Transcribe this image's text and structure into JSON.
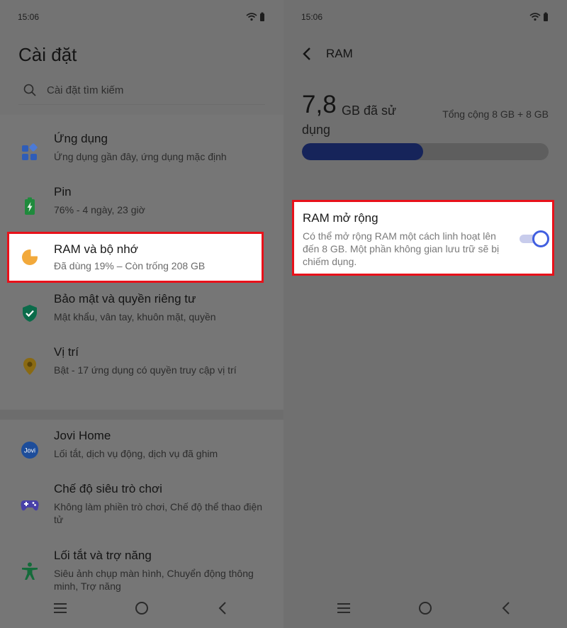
{
  "left": {
    "status_time": "15:06",
    "title": "Cài đặt",
    "search_placeholder": "Cài đặt tìm kiếm",
    "items": [
      {
        "title": "Ứng dụng",
        "subtitle": "Ứng dụng gần đây, ứng dụng mặc định",
        "icon": "apps-icon"
      },
      {
        "title": "Pin",
        "subtitle": "76% - 4 ngày, 23 giờ",
        "icon": "battery-icon"
      },
      {
        "title": "RAM và bộ nhớ",
        "subtitle": "Đã dùng 19% – Còn trống 208 GB",
        "icon": "storage-pie-icon"
      },
      {
        "title": "Bảo mật và quyền riêng tư",
        "subtitle": "Mật khẩu, vân tay, khuôn mặt, quyền",
        "icon": "shield-icon"
      },
      {
        "title": "Vị trí",
        "subtitle": "Bật - 17 ứng dụng có quyền truy cập vị trí",
        "icon": "location-icon"
      },
      {
        "title": "Jovi Home",
        "subtitle": "Lối tắt, dịch vụ động, dịch vụ đã ghim",
        "icon": "jovi-icon",
        "icon_text": "Jovi"
      },
      {
        "title": "Chế độ siêu trò chơi",
        "subtitle": "Không làm phiền trò chơi, Chế độ thể thao điện tử",
        "icon": "gamepad-icon"
      },
      {
        "title": "Lối tắt và trợ năng",
        "subtitle": "Siêu ảnh chụp màn hình, Chuyển động thông minh, Trợ năng",
        "icon": "accessibility-icon"
      }
    ]
  },
  "right": {
    "status_time": "15:06",
    "title": "RAM",
    "used_value": "7,8",
    "used_unit_line1": "GB đã sử",
    "used_unit_line2": "dụng",
    "total": "Tổng cộng 8 GB + 8 GB",
    "usage_fraction": 0.49,
    "extended": {
      "title": "RAM mở rộng",
      "description": "Có thể mở rộng RAM một cách linh hoạt lên đến 8 GB. Một phần không gian lưu trữ sẽ bị chiếm dụng.",
      "enabled": true
    }
  },
  "colors": {
    "highlight": "#e8111a",
    "apps_icon": "#2f5db8",
    "battery_icon": "#1f8a3c",
    "storage_icon": "#f2a93b",
    "shield_icon": "#0b6b4a",
    "location_icon": "#8a6a12",
    "jovi_icon": "#1d4d9a",
    "gamepad_icon": "#4840a8",
    "accessibility_icon": "#146b3a",
    "toggle_on": "#415fe0",
    "bar_fill": "#16245a"
  }
}
